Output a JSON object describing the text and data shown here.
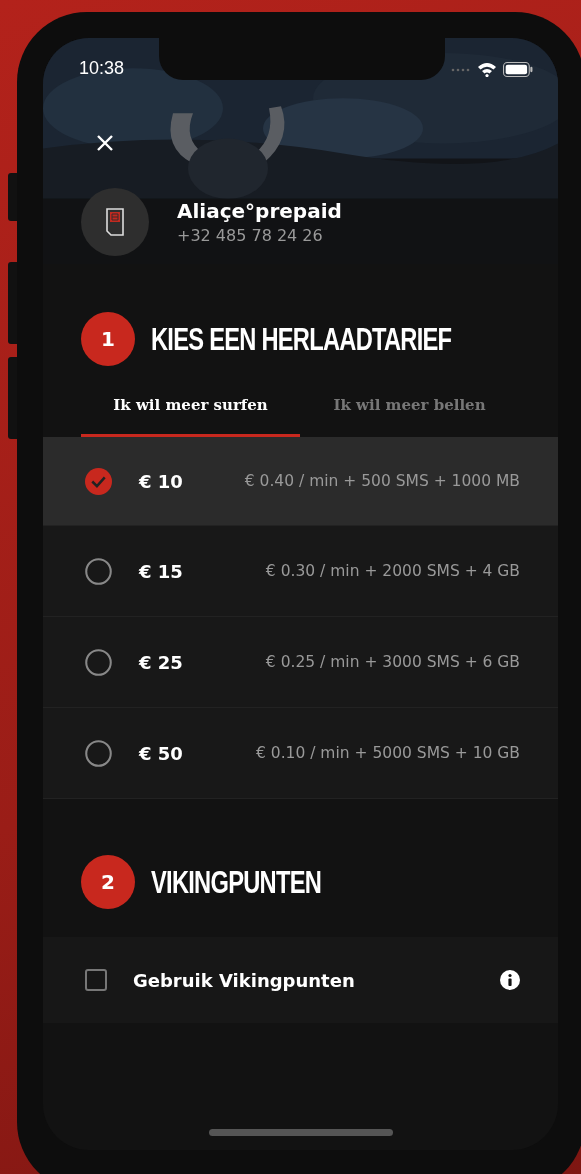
{
  "status_bar": {
    "time": "10:38"
  },
  "account": {
    "name": "Aliaçe°prepaid",
    "number": "+32 485 78 24 26"
  },
  "step_1": {
    "number": "1",
    "title": "KIES EEN HERLAADTARIEF",
    "tabs": [
      {
        "label": "Ik wil meer surfen",
        "selected": true
      },
      {
        "label": "Ik wil meer bellen",
        "selected": false
      }
    ],
    "plans": [
      {
        "price": "€ 10",
        "details": "€ 0.40 / min + 500 SMS + 1000 MB",
        "selected": true
      },
      {
        "price": "€ 15",
        "details": "€ 0.30 / min + 2000 SMS + 4 GB",
        "selected": false
      },
      {
        "price": "€ 25",
        "details": "€ 0.25 / min + 3000 SMS + 6 GB",
        "selected": false
      },
      {
        "price": "€ 50",
        "details": "€ 0.10 / min + 5000 SMS + 10 GB",
        "selected": false
      }
    ]
  },
  "step_2": {
    "number": "2",
    "title": "VIKINGPUNTEN",
    "option": {
      "label": "Gebruik Vikingpunten",
      "checked": false
    }
  }
}
